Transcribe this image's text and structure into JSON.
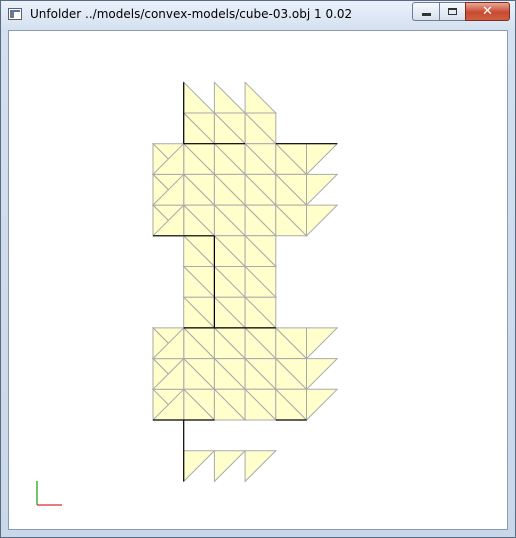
{
  "window": {
    "title": "Unfolder ../models/convex-models/cube-03.obj 1 0.02"
  },
  "caption_buttons": {
    "minimize": "minimize",
    "maximize": "maximize",
    "close": "✕"
  },
  "colors": {
    "face_fill": "#ffffcc",
    "edge": "#aaaaaa",
    "cut_edge": "#000000",
    "axis_x": "#e05050",
    "axis_y": "#40b040"
  },
  "unfolding": {
    "grid_columns": 5,
    "grid_rows": 11,
    "face_shape": "right-triangle"
  }
}
